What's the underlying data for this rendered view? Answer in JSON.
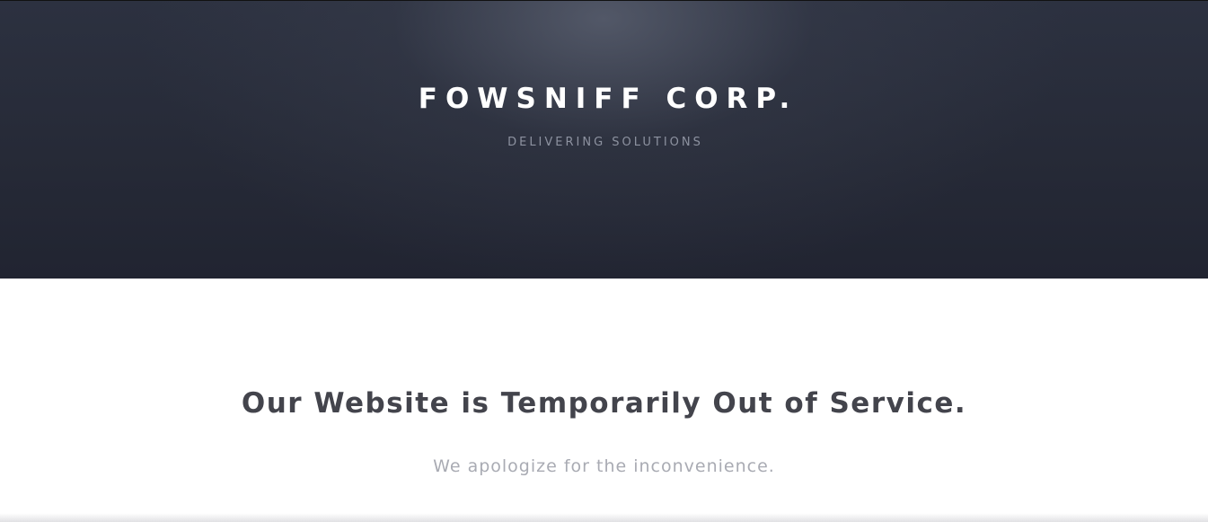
{
  "header": {
    "title": "FOWSNIFF CORP.",
    "tagline": "DELIVERING SOLUTIONS"
  },
  "main": {
    "heading": "Our Website is Temporarily Out of Service.",
    "subtext": "We apologize for the inconvenience."
  },
  "colors": {
    "hero_background": "#262a37",
    "heading_text": "#43444c",
    "subtext": "#a9abb3",
    "tagline": "#8d92a0"
  }
}
